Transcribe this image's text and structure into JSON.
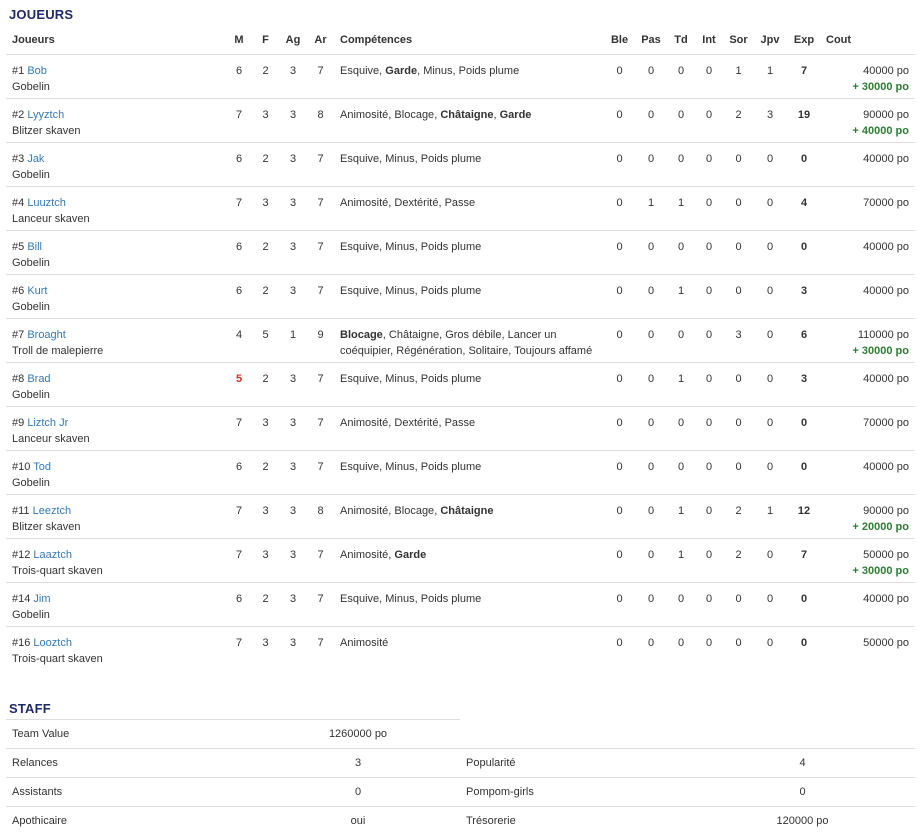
{
  "players_section": {
    "title": "JOUEURS"
  },
  "headers": {
    "players": "Joueurs",
    "m": "M",
    "f": "F",
    "ag": "Ag",
    "ar": "Ar",
    "skills": "Compétences",
    "ble": "Ble",
    "pas": "Pas",
    "td": "Td",
    "int": "Int",
    "sor": "Sor",
    "jpv": "Jpv",
    "exp": "Exp",
    "cost": "Cout"
  },
  "players": [
    {
      "num": "#1",
      "name": "Bob",
      "type": "Gobelin",
      "m": "6",
      "f": "2",
      "ag": "3",
      "ar": "7",
      "skills": [
        {
          "t": "Esquive",
          "b": false
        },
        {
          "t": "Garde",
          "b": true
        },
        {
          "t": "Minus",
          "b": false
        },
        {
          "t": "Poids plume",
          "b": false
        }
      ],
      "ble": "0",
      "pas": "0",
      "td": "0",
      "int": "0",
      "sor": "1",
      "jpv": "1",
      "exp": "7",
      "cost": "40000 po",
      "bonus": "+ 30000 po"
    },
    {
      "num": "#2",
      "name": "Lyyztch",
      "type": "Blitzer skaven",
      "m": "7",
      "f": "3",
      "ag": "3",
      "ar": "8",
      "skills": [
        {
          "t": "Animosité",
          "b": false
        },
        {
          "t": "Blocage",
          "b": false
        },
        {
          "t": "Châtaigne",
          "b": true
        },
        {
          "t": "Garde",
          "b": true
        }
      ],
      "ble": "0",
      "pas": "0",
      "td": "0",
      "int": "0",
      "sor": "2",
      "jpv": "3",
      "exp": "19",
      "cost": "90000 po",
      "bonus": "+ 40000 po"
    },
    {
      "num": "#3",
      "name": "Jak",
      "type": "Gobelin",
      "m": "6",
      "f": "2",
      "ag": "3",
      "ar": "7",
      "skills": [
        {
          "t": "Esquive",
          "b": false
        },
        {
          "t": "Minus",
          "b": false
        },
        {
          "t": "Poids plume",
          "b": false
        }
      ],
      "ble": "0",
      "pas": "0",
      "td": "0",
      "int": "0",
      "sor": "0",
      "jpv": "0",
      "exp": "0",
      "cost": "40000 po",
      "bonus": ""
    },
    {
      "num": "#4",
      "name": "Luuztch",
      "type": "Lanceur skaven",
      "m": "7",
      "f": "3",
      "ag": "3",
      "ar": "7",
      "skills": [
        {
          "t": "Animosité",
          "b": false
        },
        {
          "t": "Dextérité",
          "b": false
        },
        {
          "t": "Passe",
          "b": false
        }
      ],
      "ble": "0",
      "pas": "1",
      "td": "1",
      "int": "0",
      "sor": "0",
      "jpv": "0",
      "exp": "4",
      "cost": "70000 po",
      "bonus": ""
    },
    {
      "num": "#5",
      "name": "Bill",
      "type": "Gobelin",
      "m": "6",
      "f": "2",
      "ag": "3",
      "ar": "7",
      "skills": [
        {
          "t": "Esquive",
          "b": false
        },
        {
          "t": "Minus",
          "b": false
        },
        {
          "t": "Poids plume",
          "b": false
        }
      ],
      "ble": "0",
      "pas": "0",
      "td": "0",
      "int": "0",
      "sor": "0",
      "jpv": "0",
      "exp": "0",
      "cost": "40000 po",
      "bonus": ""
    },
    {
      "num": "#6",
      "name": "Kurt",
      "type": "Gobelin",
      "m": "6",
      "f": "2",
      "ag": "3",
      "ar": "7",
      "skills": [
        {
          "t": "Esquive",
          "b": false
        },
        {
          "t": "Minus",
          "b": false
        },
        {
          "t": "Poids plume",
          "b": false
        }
      ],
      "ble": "0",
      "pas": "0",
      "td": "1",
      "int": "0",
      "sor": "0",
      "jpv": "0",
      "exp": "3",
      "cost": "40000 po",
      "bonus": ""
    },
    {
      "num": "#7",
      "name": "Broaght",
      "type": "Troll de malepierre",
      "m": "4",
      "f": "5",
      "ag": "1",
      "ar": "9",
      "skills": [
        {
          "t": "Blocage",
          "b": true
        },
        {
          "t": "Châtaigne",
          "b": false
        },
        {
          "t": "Gros débile",
          "b": false
        },
        {
          "t": "Lancer un coéquipier",
          "b": false
        },
        {
          "t": "Régénération",
          "b": false
        },
        {
          "t": "Solitaire",
          "b": false
        },
        {
          "t": "Toujours affamé",
          "b": false
        }
      ],
      "ble": "0",
      "pas": "0",
      "td": "0",
      "int": "0",
      "sor": "3",
      "jpv": "0",
      "exp": "6",
      "cost": "110000 po",
      "bonus": "+ 30000 po"
    },
    {
      "num": "#8",
      "name": "Brad",
      "type": "Gobelin",
      "m": "5",
      "m_red": true,
      "f": "2",
      "ag": "3",
      "ar": "7",
      "skills": [
        {
          "t": "Esquive",
          "b": false
        },
        {
          "t": "Minus",
          "b": false
        },
        {
          "t": "Poids plume",
          "b": false
        }
      ],
      "ble": "0",
      "pas": "0",
      "td": "1",
      "int": "0",
      "sor": "0",
      "jpv": "0",
      "exp": "3",
      "cost": "40000 po",
      "bonus": ""
    },
    {
      "num": "#9",
      "name": "Liztch Jr",
      "type": "Lanceur skaven",
      "m": "7",
      "f": "3",
      "ag": "3",
      "ar": "7",
      "skills": [
        {
          "t": "Animosité",
          "b": false
        },
        {
          "t": "Dextérité",
          "b": false
        },
        {
          "t": "Passe",
          "b": false
        }
      ],
      "ble": "0",
      "pas": "0",
      "td": "0",
      "int": "0",
      "sor": "0",
      "jpv": "0",
      "exp": "0",
      "cost": "70000 po",
      "bonus": ""
    },
    {
      "num": "#10",
      "name": "Tod",
      "type": "Gobelin",
      "m": "6",
      "f": "2",
      "ag": "3",
      "ar": "7",
      "skills": [
        {
          "t": "Esquive",
          "b": false
        },
        {
          "t": "Minus",
          "b": false
        },
        {
          "t": "Poids plume",
          "b": false
        }
      ],
      "ble": "0",
      "pas": "0",
      "td": "0",
      "int": "0",
      "sor": "0",
      "jpv": "0",
      "exp": "0",
      "cost": "40000 po",
      "bonus": ""
    },
    {
      "num": "#11",
      "name": "Leeztch",
      "type": "Blitzer skaven",
      "m": "7",
      "f": "3",
      "ag": "3",
      "ar": "8",
      "skills": [
        {
          "t": "Animosité",
          "b": false
        },
        {
          "t": "Blocage",
          "b": false
        },
        {
          "t": "Châtaigne",
          "b": true
        }
      ],
      "ble": "0",
      "pas": "0",
      "td": "1",
      "int": "0",
      "sor": "2",
      "jpv": "1",
      "exp": "12",
      "cost": "90000 po",
      "bonus": "+ 20000 po"
    },
    {
      "num": "#12",
      "name": "Laaztch",
      "type": "Trois-quart skaven",
      "m": "7",
      "f": "3",
      "ag": "3",
      "ar": "7",
      "skills": [
        {
          "t": "Animosité",
          "b": false
        },
        {
          "t": "Garde",
          "b": true
        }
      ],
      "ble": "0",
      "pas": "0",
      "td": "1",
      "int": "0",
      "sor": "2",
      "jpv": "0",
      "exp": "7",
      "cost": "50000 po",
      "bonus": "+ 30000 po"
    },
    {
      "num": "#14",
      "name": "Jim",
      "type": "Gobelin",
      "m": "6",
      "f": "2",
      "ag": "3",
      "ar": "7",
      "skills": [
        {
          "t": "Esquive",
          "b": false
        },
        {
          "t": "Minus",
          "b": false
        },
        {
          "t": "Poids plume",
          "b": false
        }
      ],
      "ble": "0",
      "pas": "0",
      "td": "0",
      "int": "0",
      "sor": "0",
      "jpv": "0",
      "exp": "0",
      "cost": "40000 po",
      "bonus": ""
    },
    {
      "num": "#16",
      "name": "Looztch",
      "type": "Trois-quart skaven",
      "m": "7",
      "f": "3",
      "ag": "3",
      "ar": "7",
      "skills": [
        {
          "t": "Animosité",
          "b": false
        }
      ],
      "ble": "0",
      "pas": "0",
      "td": "0",
      "int": "0",
      "sor": "0",
      "jpv": "0",
      "exp": "0",
      "cost": "50000 po",
      "bonus": ""
    }
  ],
  "staff_section": {
    "title": "STAFF"
  },
  "staff": {
    "team_value_label": "Team Value",
    "team_value": "1260000 po",
    "rerolls_label": "Relances",
    "rerolls": "3",
    "popularity_label": "Popularité",
    "popularity": "4",
    "assistants_label": "Assistants",
    "assistants": "0",
    "cheerleaders_label": "Pompom-girls",
    "cheerleaders": "0",
    "apothecary_label": "Apothicaire",
    "apothecary": "oui",
    "treasury_label": "Trésorerie",
    "treasury": "120000 po"
  },
  "colors": {
    "title": "#1f2a6b",
    "link": "#337ab7",
    "bonus": "#2e7d32",
    "injured": "#c9302c",
    "border": "#dddddd"
  }
}
